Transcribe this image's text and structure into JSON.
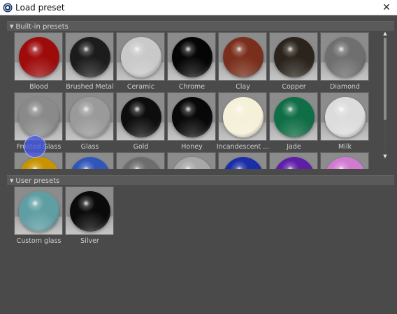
{
  "window": {
    "title": "Load preset",
    "app_icon": "cinema4d-logo-icon",
    "close_glyph": "✕"
  },
  "builtin": {
    "header": "Built-in presets",
    "presets": [
      {
        "label": "Blood",
        "color": "#9e0b0b"
      },
      {
        "label": "Brushed Metal",
        "color": "#1c1c1c"
      },
      {
        "label": "Ceramic",
        "color": "#c9c9c9"
      },
      {
        "label": "Chrome",
        "color": "#050505"
      },
      {
        "label": "Clay",
        "color": "#7a2f1c"
      },
      {
        "label": "Copper",
        "color": "#2a241c"
      },
      {
        "label": "Diamond",
        "color": "#6f6f6f"
      },
      {
        "label": "Frosted Glass",
        "color": "#8a8a8a"
      },
      {
        "label": "Glass",
        "color": "#9a9a9a"
      },
      {
        "label": "Gold",
        "color": "#0d0d0d"
      },
      {
        "label": "Honey",
        "color": "#080808"
      },
      {
        "label": "Incandescent ...",
        "color": "#f5f0d8"
      },
      {
        "label": "Jade",
        "color": "#0f6e45"
      },
      {
        "label": "Milk",
        "color": "#dcdcdc"
      },
      {
        "label": "",
        "color": "#c79400"
      },
      {
        "label": "",
        "color": "#2f56b8"
      },
      {
        "label": "",
        "color": "#6d6d6d"
      },
      {
        "label": "",
        "color": "#a8a8a8"
      },
      {
        "label": "",
        "color": "#1a2ea8"
      },
      {
        "label": "",
        "color": "#5e1ea8"
      },
      {
        "label": "",
        "color": "#d07ad0"
      }
    ]
  },
  "user": {
    "header": "User presets",
    "presets": [
      {
        "label": "Custom glass",
        "color": "#5f9ea3"
      },
      {
        "label": "Silver",
        "color": "#0a0a0a"
      }
    ]
  },
  "scrollbar": {
    "up_glyph": "▲",
    "down_glyph": "▼"
  },
  "section_glyph": "▼"
}
